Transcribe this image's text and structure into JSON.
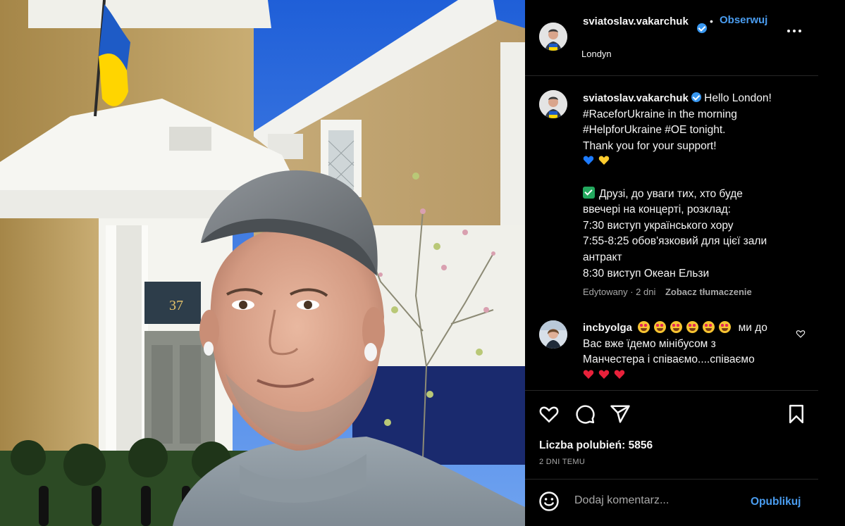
{
  "header": {
    "username": "sviatoslav.vakarchuk",
    "separator": "•",
    "follow_label": "Obserwuj",
    "location": "Londyn",
    "more_icon": "more-options-icon"
  },
  "caption": {
    "username": "sviatoslav.vakarchuk",
    "line1": "Hello London!",
    "line2": "#RaceforUkraine in the morning",
    "line3": "#HelpforUkraine #OE tonight.",
    "line4": "Thank you for your support!",
    "line6": "Друзі, до уваги тих, хто буде",
    "line7": "ввечері на концерті, розклад:",
    "line8": "7:30 виступ українського хору",
    "line9": "7:55-8:25 обов'язковий для цієї зали",
    "line10": "антракт",
    "line11": "8:30 виступ Океан Ельзи",
    "hearts": [
      "blue-heart-emoji",
      "yellow-heart-emoji"
    ],
    "check_emoji": "check-mark-button-emoji"
  },
  "meta": {
    "edited": "Edytowany · 2 dni",
    "translate": "Zobacz tłumaczenie"
  },
  "comment": {
    "username": "incbyolga",
    "line1": "ми до",
    "line2": "Вас вже їдемо мінібусом з",
    "line3": "Манчестера і співаємо....співаємо",
    "emojis": [
      "smiling-face-with-heart-eyes",
      "smiling-face-with-heart-eyes",
      "smiling-face-with-heart-eyes",
      "smiling-face-with-heart-eyes",
      "smiling-face-with-heart-eyes",
      "smiling-face-with-heart-eyes"
    ],
    "hearts": [
      "red-heart",
      "red-heart",
      "red-heart"
    ]
  },
  "actions": {
    "like_icon": "heart-icon",
    "comment_icon": "comment-icon",
    "share_icon": "share-icon",
    "save_icon": "bookmark-icon"
  },
  "likes": "Liczba polubień: 5856",
  "date": "2 DNI TEMU",
  "add_comment": {
    "placeholder": "Dodaj komentarz...",
    "emoji_icon": "emoji-icon",
    "publish_label": "Opublikuj"
  },
  "colors": {
    "background": "#000000",
    "text": "#f5f5f5",
    "muted": "#a8a8a8",
    "accent": "#4a9df0",
    "verified": "#3897f0"
  }
}
